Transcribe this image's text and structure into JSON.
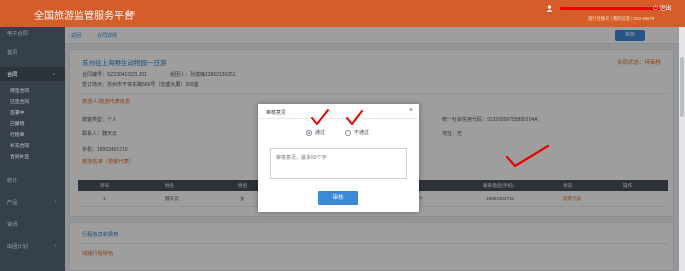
{
  "topbar": {
    "title": "全国旅游监管服务平台",
    "version": "试用",
    "logout": "⏻ 退出",
    "info": "旅行社账号 | 我的信息 | 023-45678"
  },
  "sidebar": {
    "items": [
      {
        "label": "电子合同"
      },
      {
        "label": "首页"
      },
      {
        "label": "合同"
      },
      {
        "label": "待签合同"
      },
      {
        "label": "已签合同"
      },
      {
        "label": "签署中"
      },
      {
        "label": "已撤销"
      },
      {
        "label": "行程单"
      },
      {
        "label": "补充合同"
      },
      {
        "label": "合同补签"
      },
      {
        "label": "统计"
      },
      {
        "label": "产品"
      },
      {
        "label": "资讯"
      },
      {
        "label": "出团计划"
      }
    ]
  },
  "breadcrumb": {
    "back": "‹ 返回",
    "current": "合同详情",
    "button": "审核"
  },
  "contract": {
    "title": "苏州往上海野生动物园一日游",
    "status": "合同状态：待审核",
    "number": "合同编号：SZ2304132ZLJ01",
    "organizer": "组团人：孙成梅13862136251",
    "location": "签订地点：苏州市干将东路566号（宏盛大厦）309室",
    "section_travelers": "旅游人/旅游代表信息",
    "traveler_type": "旅客类型：个人",
    "contact": "联系人：魏天云",
    "phone": "手机：18952401710",
    "credit_code": "统一社会信用代码：91320506755895104A",
    "address": "地址：无",
    "section_list": "旅游名单（游客代表）",
    "section_itinerary": "行程信息和费用",
    "itinerary_sub": "线路行程特色"
  },
  "table": {
    "headers": [
      "序号",
      "姓名",
      "性别",
      "证件类型",
      "证件号码",
      "联系电话(手机)",
      "状态",
      "操作"
    ],
    "rows": [
      [
        "1",
        "魏天云",
        "女",
        "身份证",
        "3205********",
        "18952401710",
        "游客代表",
        ""
      ]
    ]
  },
  "modal": {
    "title": "审核意见",
    "close": "×",
    "option_pass": "通过",
    "option_reject": "不通过",
    "selected": "通过",
    "placeholder": "审核意见，最多50个字",
    "submit": "审核"
  },
  "colors": {
    "brand": "#d45d2a",
    "accent": "#3a8ad8",
    "annotation": "#e00000"
  }
}
